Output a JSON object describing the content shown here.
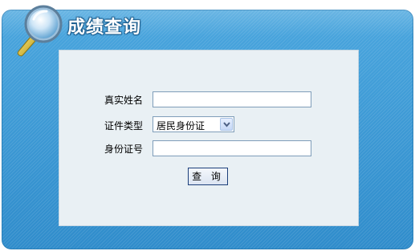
{
  "header": {
    "title": "成绩查询",
    "icon": "magnifier-icon"
  },
  "form": {
    "name_label": "真实姓名",
    "name_value": "",
    "id_type_label": "证件类型",
    "id_type_selected": "居民身份证",
    "id_number_label": "身份证号",
    "id_number_value": "",
    "submit_label": "查 询"
  },
  "colors": {
    "panel": "#3a97d2",
    "content_bg": "#e9f0f4",
    "input_border": "#7f9db9",
    "button_border": "#1c3f7a"
  }
}
